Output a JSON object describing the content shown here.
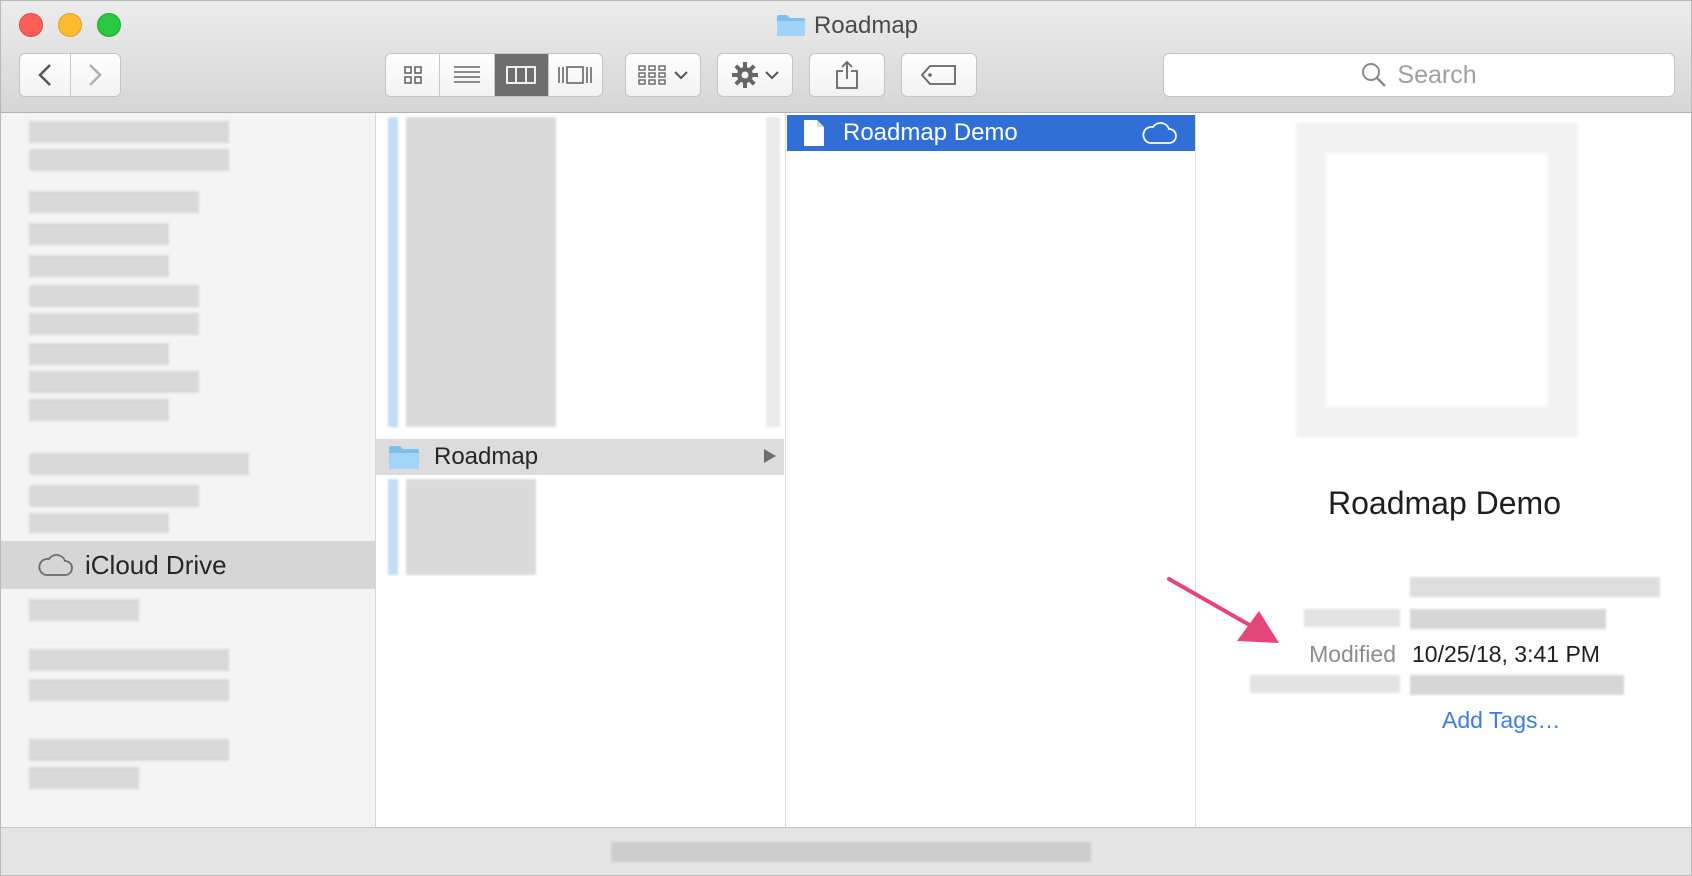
{
  "window": {
    "title": "Roadmap"
  },
  "toolbar": {
    "views": [
      "icon-view",
      "list-view",
      "column-view",
      "gallery-view"
    ],
    "search_placeholder": "Search"
  },
  "sidebar": {
    "selected_item": "iCloud Drive"
  },
  "column2": {
    "selected_folder": "Roadmap"
  },
  "column3": {
    "selected_file": "Roadmap Demo"
  },
  "preview": {
    "file_name": "Roadmap Demo",
    "modified_label": "Modified",
    "modified_value": "10/25/18, 3:41 PM",
    "add_tags": "Add Tags…"
  },
  "colors": {
    "selection_blue": "#2f6fd6",
    "annotation_arrow": "#e6457a",
    "link_blue": "#3b7fd9"
  }
}
